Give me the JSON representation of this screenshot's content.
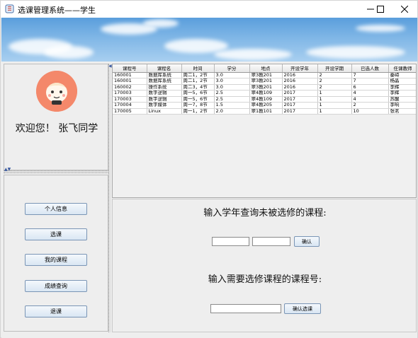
{
  "window": {
    "title": "选课管理系统——学生"
  },
  "user": {
    "welcome": "欢迎您！ 张飞同学"
  },
  "nav": [
    {
      "label": "个人信息"
    },
    {
      "label": "选课"
    },
    {
      "label": "我的课程"
    },
    {
      "label": "成绩查询"
    },
    {
      "label": "退课"
    }
  ],
  "table": {
    "columns": [
      "课程号",
      "课程名",
      "时间",
      "学分",
      "地点",
      "开设学年",
      "开设学期",
      "已选人数",
      "任课教师"
    ],
    "rows": [
      [
        "160001",
        "数据库系统",
        "周二1，2节",
        "3.0",
        "翠3教201",
        "2016",
        "2",
        "7",
        "秦峙"
      ],
      [
        "160001",
        "数据库系统",
        "周二1，2节",
        "3.0",
        "翠3教201",
        "2016",
        "2",
        "7",
        "杨晶"
      ],
      [
        "160002",
        "操作系统",
        "周二3，4节",
        "3.0",
        "翠3教201",
        "2016",
        "2",
        "6",
        "李辉"
      ],
      [
        "170003",
        "数字逻辑",
        "周一5，6节",
        "2.5",
        "翠4教109",
        "2017",
        "1",
        "4",
        "李辉"
      ],
      [
        "170003",
        "数字逻辑",
        "周一5，6节",
        "2.5",
        "翠4教109",
        "2017",
        "1",
        "4",
        "苏醒"
      ],
      [
        "170004",
        "数字媒体",
        "周一7，8节",
        "1.5",
        "翠4教205",
        "2017",
        "1",
        "2",
        "李响"
      ],
      [
        "170005",
        "Linux",
        "周一1，2节",
        "2.0",
        "翠1教101",
        "2017",
        "1",
        "10",
        "张茗"
      ]
    ]
  },
  "query": {
    "heading": "输入学年查询未被选修的课程:",
    "year_from": "",
    "year_to": "",
    "confirm_label": "确认"
  },
  "select": {
    "heading": "输入需要选修课程的课程号:",
    "course_id": "",
    "confirm_label": "确认选课"
  },
  "colors": {
    "banner_sky": "#7fb6e6",
    "avatar_bg": "#f4886a",
    "button_border": "#7a95b5"
  }
}
